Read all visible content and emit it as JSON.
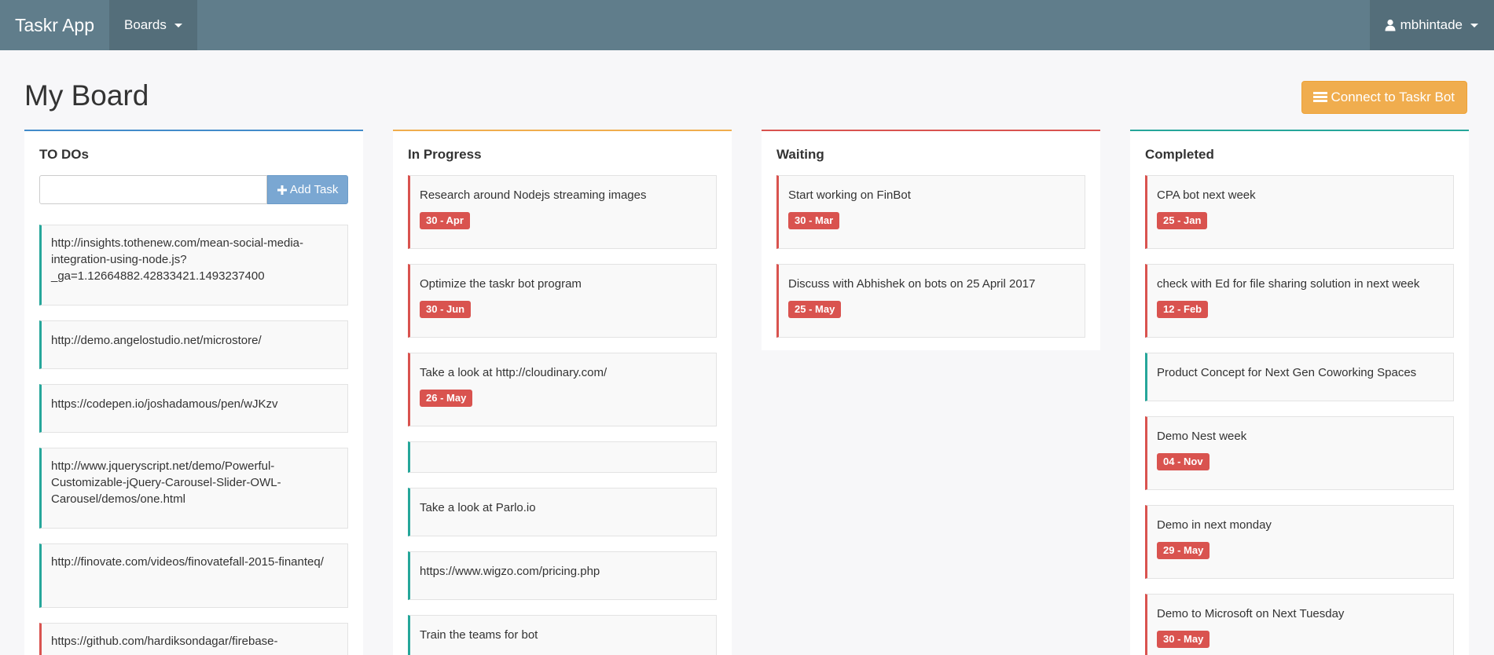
{
  "navbar": {
    "brand": "Taskr App",
    "boards_label": "Boards",
    "user_label": "mbhintade"
  },
  "page": {
    "title": "My Board",
    "bot_button_label": "Connect to Taskr Bot"
  },
  "columns": {
    "todo": {
      "title": "TO DOs",
      "add_placeholder": "",
      "add_value": "",
      "add_button_label": "Add Task",
      "cards": [
        {
          "text": "http://insights.tothenew.com/mean-social-media-integration-using-node.js?_ga=1.12664882.42833421.1493237400",
          "date": ""
        },
        {
          "text": "http://demo.angelostudio.net/microstore/",
          "date": ""
        },
        {
          "text": "https://codepen.io/joshadamous/pen/wJKzv",
          "date": ""
        },
        {
          "text": "http://www.jqueryscript.net/demo/Powerful-Customizable-jQuery-Carousel-Slider-OWL-Carousel/demos/one.html",
          "date": ""
        },
        {
          "text": "http://finovate.com/videos/finovatefall-2015-finanteq/",
          "date": ""
        },
        {
          "text": "https://github.com/hardiksondagar/firebase-",
          "date": ""
        }
      ]
    },
    "progress": {
      "title": "In Progress",
      "cards": [
        {
          "text": "Research around Nodejs streaming images",
          "date": "30 - Apr"
        },
        {
          "text": "Optimize the taskr bot program",
          "date": "30 - Jun"
        },
        {
          "text": "Take a look at http://cloudinary.com/",
          "date": "26 - May"
        },
        {
          "text": "",
          "date": ""
        },
        {
          "text": "Take a look at Parlo.io",
          "date": ""
        },
        {
          "text": "https://www.wigzo.com/pricing.php",
          "date": ""
        },
        {
          "text": "Train the teams for bot",
          "date": ""
        }
      ]
    },
    "waiting": {
      "title": "Waiting",
      "cards": [
        {
          "text": "Start working on FinBot",
          "date": "30 - Mar"
        },
        {
          "text": "Discuss with Abhishek on bots on 25 April 2017",
          "date": "25 - May"
        }
      ]
    },
    "completed": {
      "title": "Completed",
      "cards": [
        {
          "text": "CPA bot next week",
          "date": "25 - Jan"
        },
        {
          "text": "check with Ed for file sharing solution in next week",
          "date": "12 - Feb"
        },
        {
          "text": "Product Concept for Next Gen Coworking Spaces",
          "date": ""
        },
        {
          "text": "Demo Nest week",
          "date": "04 - Nov"
        },
        {
          "text": "Demo in next monday",
          "date": "29 - May"
        },
        {
          "text": "Demo to Microsoft on Next Tuesday",
          "date": "30 - May"
        }
      ]
    }
  },
  "icons": {
    "user": "user-icon",
    "bars": "bars-icon",
    "plus": "plus-icon",
    "caret": "caret-down-icon"
  },
  "colors": {
    "navbar": "#607d8b",
    "navbar_active": "#546e7a",
    "todo_accent": "#428bca",
    "progress_accent": "#f0ad4e",
    "waiting_accent": "#d9534f",
    "completed_accent": "#26a69a",
    "badge": "#d9534f",
    "bot_button": "#f0ad4e"
  }
}
